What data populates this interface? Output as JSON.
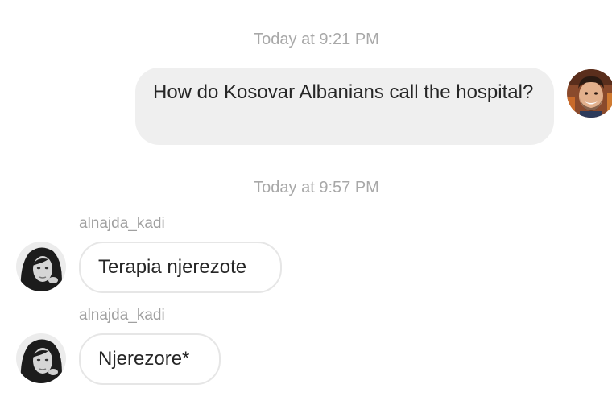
{
  "conversation": {
    "timestamps": [
      "Today at 9:21 PM",
      "Today at 9:57 PM"
    ],
    "messages": [
      {
        "direction": "outgoing",
        "text": "How do Kosovar Albanians call the hospital?"
      },
      {
        "direction": "incoming",
        "username": "alnajda_kadi",
        "text": "Terapia njerezote"
      },
      {
        "direction": "incoming",
        "username": "alnajda_kadi",
        "text": "Njerezore*"
      }
    ]
  },
  "colors": {
    "outgoing_bubble": "#efefef",
    "incoming_border": "#e6e6e6",
    "timestamp_text": "#a8a8a8",
    "message_text": "#262626"
  },
  "icons": {
    "self_avatar": "user-avatar-photo",
    "other_avatar": "contact-avatar-photo"
  }
}
